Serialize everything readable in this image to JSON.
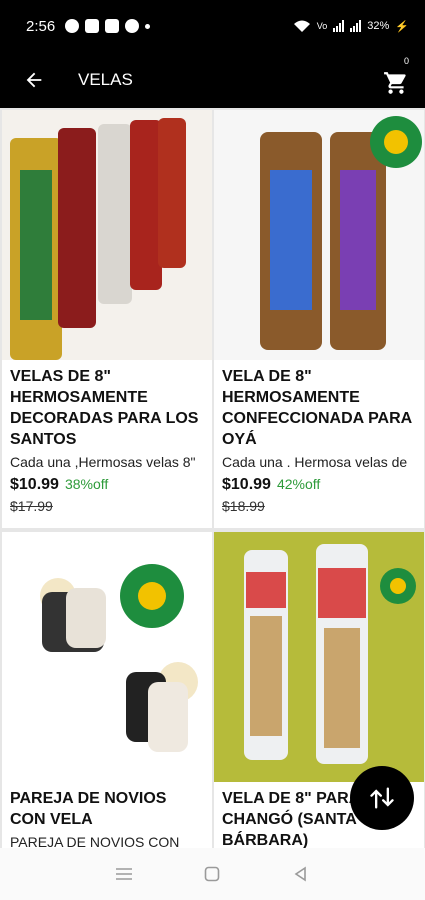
{
  "status": {
    "time": "2:56",
    "battery": "32%"
  },
  "app_bar": {
    "title": "VELAS",
    "cart_count": "0"
  },
  "products": [
    {
      "title": "VELAS DE 8\" HERMOSAMENTE DECORADAS PARA LOS SANTOS",
      "description": "Cada una ,Hermosas velas 8\"",
      "price": "$10.99",
      "discount": "38%off",
      "original_price": "$17.99"
    },
    {
      "title": "VELA DE 8\" HERMOSAMENTE CONFECCIONADA PARA OYÁ",
      "description": "Cada una . Hermosa velas de",
      "price": "$10.99",
      "discount": "42%off",
      "original_price": "$18.99"
    },
    {
      "title": "PAREJA DE NOVIOS CON VELA",
      "description": "PAREJA DE NOVIOS CON",
      "price": "",
      "discount": "",
      "original_price": ""
    },
    {
      "title": "VELA DE 8\" PARA CHANGÓ (SANTA BÁRBARA)",
      "description": "",
      "price": "",
      "discount": "",
      "original_price": ""
    }
  ],
  "colors": {
    "discount_green": "#2e9b3a",
    "bar_black": "#000000"
  }
}
